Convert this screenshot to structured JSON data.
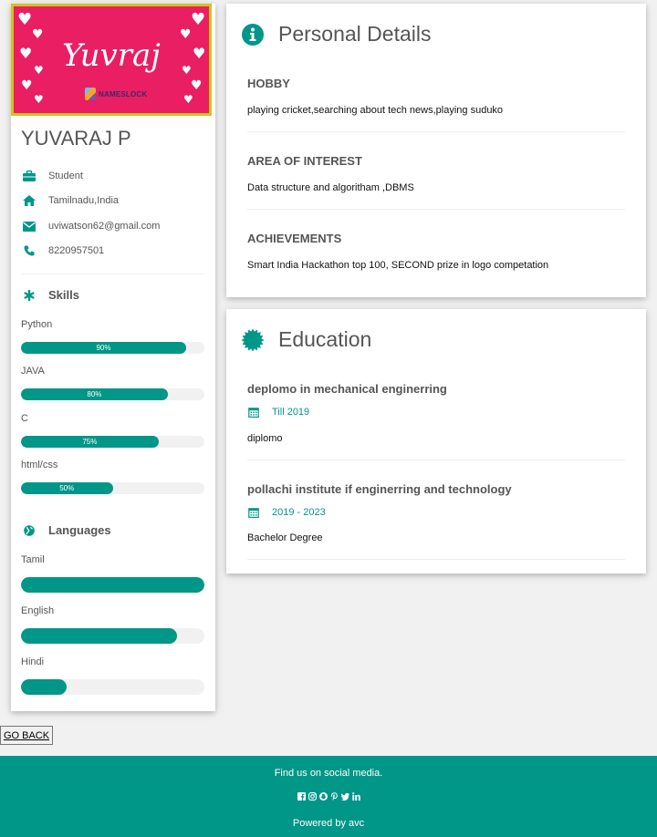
{
  "profile": {
    "banner_name": "Yuvraj",
    "banner_logo_text": "NAMESLOCK",
    "name": "YUVARAJ P",
    "occupation": "Student",
    "location": "Tamilnadu,India",
    "email": "uviwatson62@gmail.com",
    "phone": "8220957501"
  },
  "skills": {
    "title": "Skills",
    "items": [
      {
        "name": "Python",
        "percent": 90,
        "label": "90%"
      },
      {
        "name": "JAVA",
        "percent": 80,
        "label": "80%"
      },
      {
        "name": "C",
        "percent": 75,
        "label": "75%"
      },
      {
        "name": "html/css",
        "percent": 50,
        "label": "50%"
      }
    ]
  },
  "languages": {
    "title": "Languages",
    "items": [
      {
        "name": "Tamil",
        "level": 1.0
      },
      {
        "name": "English",
        "level": 0.85
      },
      {
        "name": "Hindi",
        "level": 0.25
      }
    ]
  },
  "personal": {
    "title": "Personal Details",
    "sections": [
      {
        "heading": "HOBBY",
        "text": "playing cricket,searching about tech news,playing suduko"
      },
      {
        "heading": "AREA OF INTEREST",
        "text": "Data structure and algoritham ,DBMS"
      },
      {
        "heading": "ACHIEVEMENTS",
        "text": "Smart India Hackathon top 100, SECOND prize in logo competation"
      }
    ]
  },
  "education": {
    "title": "Education",
    "items": [
      {
        "institution": "deplomo in mechanical enginerring",
        "period": "Till 2019",
        "degree": "diplomo"
      },
      {
        "institution": "pollachi institute if enginerring and technology",
        "period": "2019 - 2023",
        "degree": "Bachelor Degree"
      }
    ]
  },
  "go_back_label": "GO BACK",
  "footer": {
    "find_text": "Find us on social media.",
    "social_icons": [
      "facebook-icon",
      "instagram-icon",
      "snapchat-icon",
      "pinterest-icon",
      "twitter-icon",
      "linkedin-icon"
    ],
    "powered_text": "Powered by avc"
  },
  "colors": {
    "accent": "#009688",
    "banner": "#e91e63",
    "banner_border": "#d4c11f",
    "page_bg": "#f1f1f1"
  }
}
